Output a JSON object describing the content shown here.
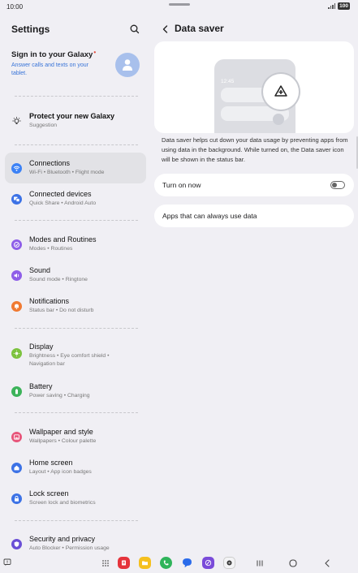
{
  "status_bar": {
    "time": "10:00",
    "battery": "100"
  },
  "left": {
    "title": "Settings",
    "account": {
      "name": "Sign in to your Galaxy",
      "subtitle": "Answer calls and texts on your tablet."
    },
    "suggestion": {
      "title": "Protect your new Galaxy",
      "subtitle": "Suggestion"
    },
    "items": [
      {
        "title": "Connections",
        "subtitle": "Wi-Fi  •  Bluetooth  •  Flight mode",
        "icon": "wifi-icon",
        "color": "#3c82f6"
      },
      {
        "title": "Connected devices",
        "subtitle": "Quick Share  •  Android Auto",
        "icon": "connected-devices-icon",
        "color": "#3c72e6"
      },
      {
        "title": "Modes and Routines",
        "subtitle": "Modes  •  Routines",
        "icon": "modes-icon",
        "color": "#8e5ee8"
      },
      {
        "title": "Sound",
        "subtitle": "Sound mode  •  Ringtone",
        "icon": "sound-icon",
        "color": "#8e5ee8"
      },
      {
        "title": "Notifications",
        "subtitle": "Status bar  •  Do not disturb",
        "icon": "notifications-icon",
        "color": "#f07a32"
      },
      {
        "title": "Display",
        "subtitle": "Brightness  •  Eye comfort shield  •  Navigation bar",
        "icon": "display-icon",
        "color": "#7cc23e"
      },
      {
        "title": "Battery",
        "subtitle": "Power saving  •  Charging",
        "icon": "battery-icon",
        "color": "#3cb35a"
      },
      {
        "title": "Wallpaper and style",
        "subtitle": "Wallpapers  •  Colour palette",
        "icon": "wallpaper-icon",
        "color": "#e7557a"
      },
      {
        "title": "Home screen",
        "subtitle": "Layout  •  App icon badges",
        "icon": "home-screen-icon",
        "color": "#3c72e6"
      },
      {
        "title": "Lock screen",
        "subtitle": "Screen lock and biometrics",
        "icon": "lock-screen-icon",
        "color": "#3c72e6"
      },
      {
        "title": "Security and privacy",
        "subtitle": "Auto Blocker  •  Permission usage",
        "icon": "security-icon",
        "color": "#6a4fd6"
      }
    ]
  },
  "right": {
    "title": "Data saver",
    "illustration_time": "12:45",
    "description": "Data saver helps cut down your data usage by preventing apps from using data in the background. While turned on, the Data saver icon will be shown in the status bar.",
    "turn_on_label": "Turn on now",
    "turn_on_state": false,
    "apps_label": "Apps that can always use data"
  },
  "nav": {
    "dock_apps": [
      "phone-flipboard-icon",
      "my-files-icon",
      "phone-icon",
      "messages-icon",
      "internet-icon",
      "camera-icon"
    ]
  }
}
